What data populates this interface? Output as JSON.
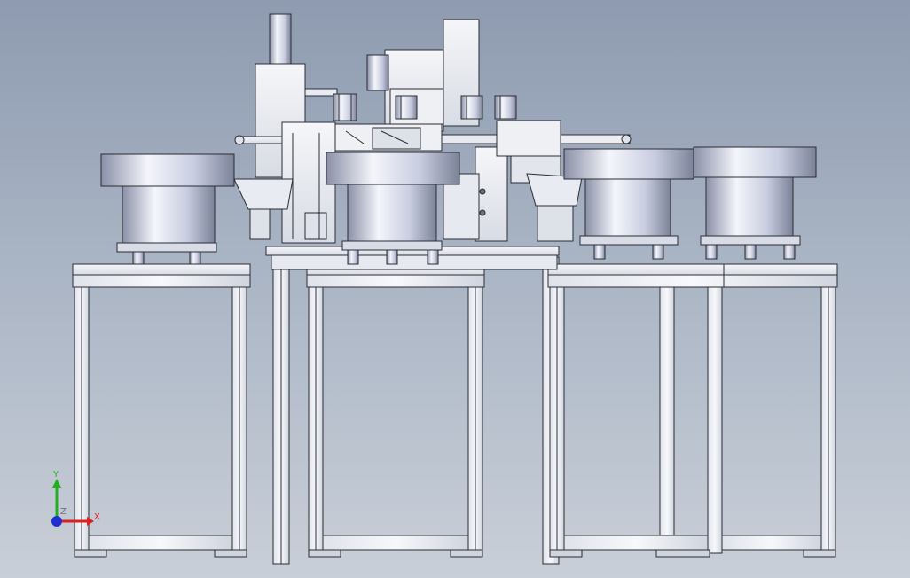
{
  "viewport": {
    "background_top": "#8e9bb0",
    "background_bottom": "#c9cfd8"
  },
  "triad": {
    "x_label": "X",
    "y_label": "Y",
    "z_label": "Z",
    "x_color": "#e02020",
    "y_color": "#20b020",
    "z_color": "#2030d0"
  },
  "colors": {
    "metal_light": "#f2f4f8",
    "metal_mid": "#c7ccd8",
    "metal_dark": "#8a90a0",
    "outline": "#2a2d33"
  }
}
